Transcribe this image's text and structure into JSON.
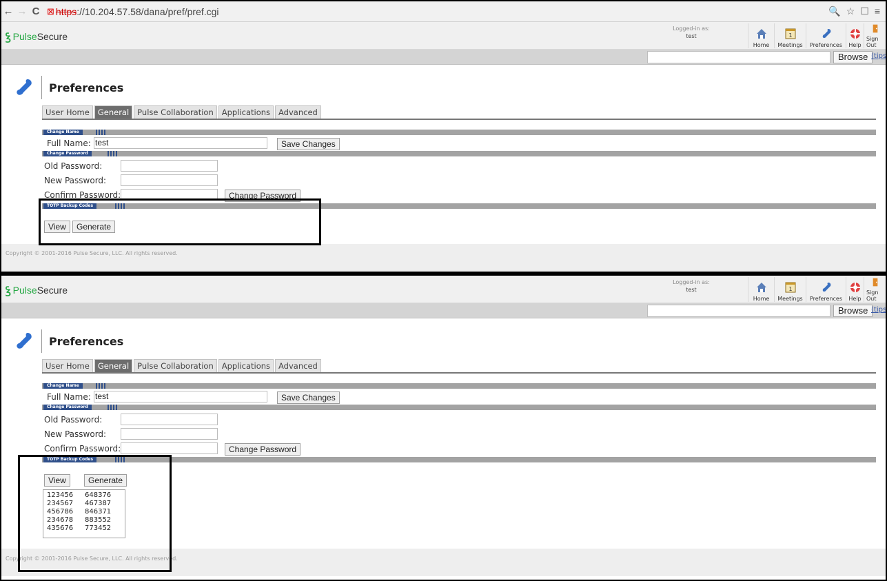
{
  "browser": {
    "back_icon": "←",
    "forward_icon": "→",
    "reload_icon": "C",
    "url_scheme": "https",
    "url_rest": "://10.204.57.58/dana/pref/pref.cgi",
    "right_icons": [
      "zoom-icon",
      "star-icon",
      "window-icon",
      "menu-icon"
    ]
  },
  "header": {
    "logo_pulse": "Pulse",
    "logo_secure": "Secure",
    "logged_in_label": "Logged-in as:",
    "user": "test",
    "nav": [
      {
        "label": "Home"
      },
      {
        "label": "Meetings"
      },
      {
        "label": "Preferences"
      },
      {
        "label": "Help"
      },
      {
        "label": "Sign Out"
      }
    ],
    "browse_label": "Browse",
    "tips_label": "(tips"
  },
  "page": {
    "title": "Preferences",
    "tabs": [
      {
        "label": "User Home",
        "active": false
      },
      {
        "label": "General",
        "active": true
      },
      {
        "label": "Pulse Collaboration",
        "active": false
      },
      {
        "label": "Applications",
        "active": false
      },
      {
        "label": "Advanced",
        "active": false
      }
    ],
    "sections": {
      "change_name": "Change Name",
      "change_password": "Change Password",
      "totp": "TOTP Backup Codes"
    },
    "full_name_label": "Full Name:",
    "full_name_value": "test",
    "save_changes": "Save Changes",
    "old_password_label": "Old Password:",
    "new_password_label": "New Password:",
    "confirm_password_label": "Confirm Password:",
    "change_password_btn": "Change Password",
    "view_btn": "View",
    "generate_btn": "Generate",
    "copyright": "Copyright © 2001-2016 Pulse Secure, LLC. All rights reserved."
  },
  "backup_codes": [
    [
      "123456",
      "648376"
    ],
    [
      "234567",
      "467387"
    ],
    [
      "456786",
      "846371"
    ],
    [
      "234678",
      "883552"
    ],
    [
      "435676",
      "773452"
    ]
  ],
  "colors": {
    "brand_green": "#27a845",
    "section_blue": "#2f4f8a",
    "tab_active": "#6d6d6d"
  }
}
